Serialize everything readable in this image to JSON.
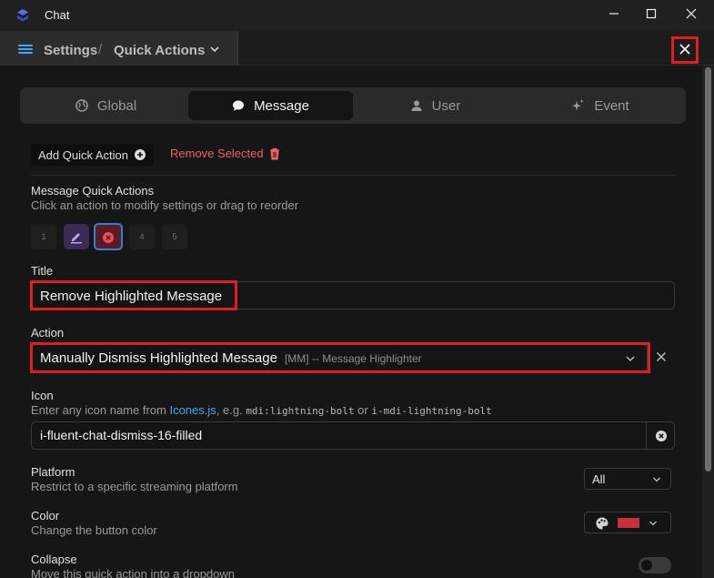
{
  "window": {
    "title": "Chat"
  },
  "header": {
    "crumb_root": "Settings",
    "separator": "/",
    "crumb_current": "Quick Actions"
  },
  "tabs": [
    {
      "label": "Global",
      "active": false
    },
    {
      "label": "Message",
      "active": true
    },
    {
      "label": "User",
      "active": false
    },
    {
      "label": "Event",
      "active": false
    }
  ],
  "toolbar": {
    "add_label": "Add Quick Action",
    "remove_label": "Remove Selected"
  },
  "quick_actions": {
    "heading": "Message Quick Actions",
    "hint": "Click an action to modify settings or drag to reorder",
    "slots": [
      "1",
      "",
      "",
      "4",
      "5"
    ]
  },
  "title_field": {
    "label": "Title",
    "value": "Remove Highlighted Message"
  },
  "action_field": {
    "label": "Action",
    "value": "Manually Dismiss Highlighted Message",
    "sub": "[MM] -- Message Highlighter"
  },
  "icon_field": {
    "label": "Icon",
    "hint_prefix": "Enter any icon name from ",
    "hint_link": "Icones.js",
    "hint_mid": ", e.g. ",
    "hint_code1": "mdi:lightning-bolt",
    "hint_or": " or ",
    "hint_code2": "i-mdi-lightning-bolt",
    "value": "i-fluent-chat-dismiss-16-filled"
  },
  "platform": {
    "label": "Platform",
    "hint": "Restrict to a specific streaming platform",
    "value": "All"
  },
  "color": {
    "label": "Color",
    "hint": "Change the button color",
    "swatch": "#c8303a"
  },
  "collapse": {
    "label": "Collapse",
    "hint": "Move this quick action into a dropdown",
    "enabled": false
  },
  "colors": {
    "accent": "#3fa7f5",
    "danger": "#f06161",
    "highlight": "#e01d25"
  }
}
